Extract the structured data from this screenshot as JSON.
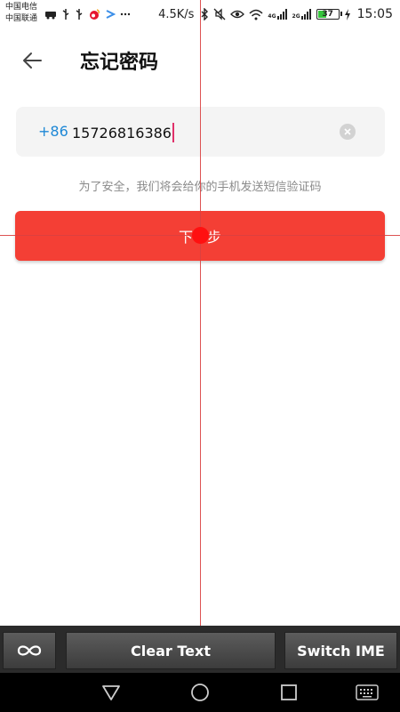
{
  "status_bar": {
    "carrier_1": "中国电信",
    "carrier_2": "中国联通",
    "icons": [
      "car-icon",
      "usb-icon",
      "usb-icon",
      "weibo-icon",
      "app-icon",
      "more-icon"
    ],
    "net_speed": "4.5K/s",
    "right_icons": [
      "bluetooth-icon",
      "mute-icon",
      "eye-icon",
      "wifi-icon",
      "signal-icon",
      "signal-icon"
    ],
    "signal_tag_1": "4G",
    "signal_tag_2": "2G",
    "battery": "37",
    "time": "15:05"
  },
  "header": {
    "back_icon": "arrow-left-icon",
    "title": "忘记密码"
  },
  "form": {
    "country_code": "+86",
    "phone_value": "15726816386",
    "clear_icon": "clear-circle-icon",
    "hint": "为了安全，我们将会给你的手机发送短信验证码",
    "next_label": "下一步"
  },
  "toolbar": {
    "loop_icon": "infinity-icon",
    "clear_text": "Clear Text",
    "switch_ime": "Switch IME"
  },
  "nav_bar": {
    "back": "triangle-back-icon",
    "home": "circle-home-icon",
    "recents": "square-recents-icon",
    "keyboard": "keyboard-icon"
  },
  "colors": {
    "accent": "#f43f35",
    "link": "#1e88d6",
    "caret": "#e0316a",
    "overlay": "#d94040"
  }
}
